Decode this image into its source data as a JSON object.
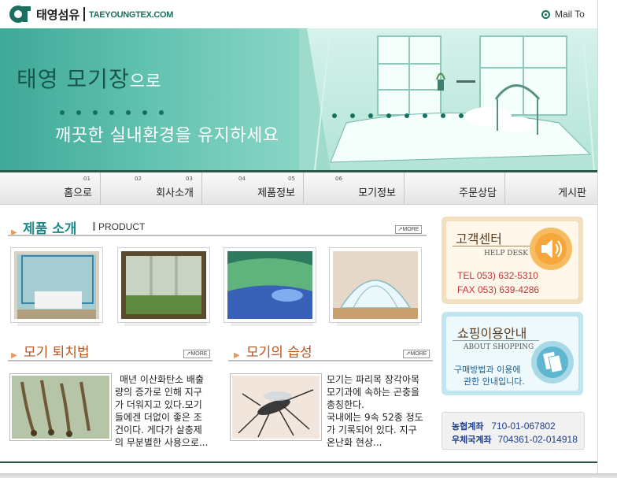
{
  "header": {
    "logo_text": "태영섬유",
    "logo_domain": "TAEYOUNGTEX.COM",
    "mail_link": "Mail To"
  },
  "hero": {
    "title_main": "태영 모기장",
    "title_suffix": "으로",
    "subtitle": "깨끗한 실내환경을 유지하세요"
  },
  "nav": [
    {
      "num": "01",
      "label": "홈으로"
    },
    {
      "num": "02",
      "label": "회사소개"
    },
    {
      "num": "03",
      "label": "제품정보"
    },
    {
      "num": "04",
      "label": "모기정보"
    },
    {
      "num": "05",
      "label": "주문상담"
    },
    {
      "num": "06",
      "label": "게시판"
    }
  ],
  "product": {
    "title": "제품 소개",
    "title_en": "PRODUCT",
    "more": "MORE"
  },
  "articles": [
    {
      "title": "모기 퇴치법",
      "more": "MORE",
      "lines": [
        "매년 이산화탄소 배출",
        "량의 증가로 인해 지구",
        "가 더워지고 있다.모기",
        "들에겐 더없이 좋은 조",
        "건이다. 게다가 살충제",
        "의 무분별한 사용으로..."
      ]
    },
    {
      "title": "모기의 습성",
      "more": "MORE",
      "lines": [
        "모기는 파리목 장각아목",
        "모기과에 속하는 곤충을",
        "총칭한다.",
        "국내에는 9속 52종 정도",
        "가 기록되어 있다. 지구",
        "온난화 현상..."
      ]
    }
  ],
  "help_desk": {
    "title": "고객센터",
    "title_en": "HELP DESK",
    "tel": "TEL 053) 632-5310",
    "fax": "FAX 053) 639-4286"
  },
  "shopping": {
    "title": "쇼핑이용안내",
    "title_en": "ABOUT SHOPPING",
    "line1": "구매방법과 이용에",
    "line2": "관한 안내입니다."
  },
  "accounts": {
    "row1_label": "농협계좌",
    "row1_number": "710-01-067802",
    "row2_label": "우체국계좌",
    "row2_number": "704361-02-014918"
  },
  "colors": {
    "brand_green": "#1a6f5f",
    "accent_teal": "#1d8a86",
    "accent_orange": "#b8561e",
    "account_blue": "#1f3f8c"
  }
}
